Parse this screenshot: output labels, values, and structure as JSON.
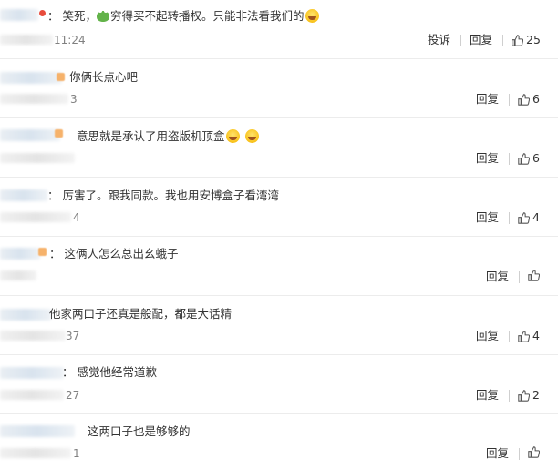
{
  "comments": [
    {
      "text_pre": "：  笑死，",
      "frog_icon": "frog-emoji-icon",
      "text_mid": "穷得买不起转播权。只能非法看我们的",
      "emoji_icons": [
        "laughing-tears-emoji-icon"
      ],
      "time": "11:24",
      "report": "投诉",
      "reply": "回复",
      "likes": "25"
    },
    {
      "text": "你俩长点心吧",
      "time": "3",
      "reply": "回复",
      "likes": "6"
    },
    {
      "text": "意思就是承认了用盗版机顶盒",
      "emoji_icons": [
        "laughing-tears-emoji-icon",
        "laughing-tears-emoji-icon"
      ],
      "reply": "回复",
      "likes": "6"
    },
    {
      "text": "：  厉害了。跟我同款。我也用安博盒子看湾湾",
      "time": "4",
      "reply": "回复",
      "likes": "4"
    },
    {
      "text": "：  这俩人怎么总出幺蛾子",
      "reply": "回复",
      "likes": ""
    },
    {
      "text": "他家两口子还真是般配，都是大话精",
      "time": "37",
      "reply": "回复",
      "likes": "4"
    },
    {
      "text": "：  感觉他经常道歉",
      "time": "27",
      "reply": "回复",
      "likes": "2"
    },
    {
      "text": "这两口子也是够够的",
      "time": "1",
      "reply": "回复",
      "likes": ""
    }
  ]
}
